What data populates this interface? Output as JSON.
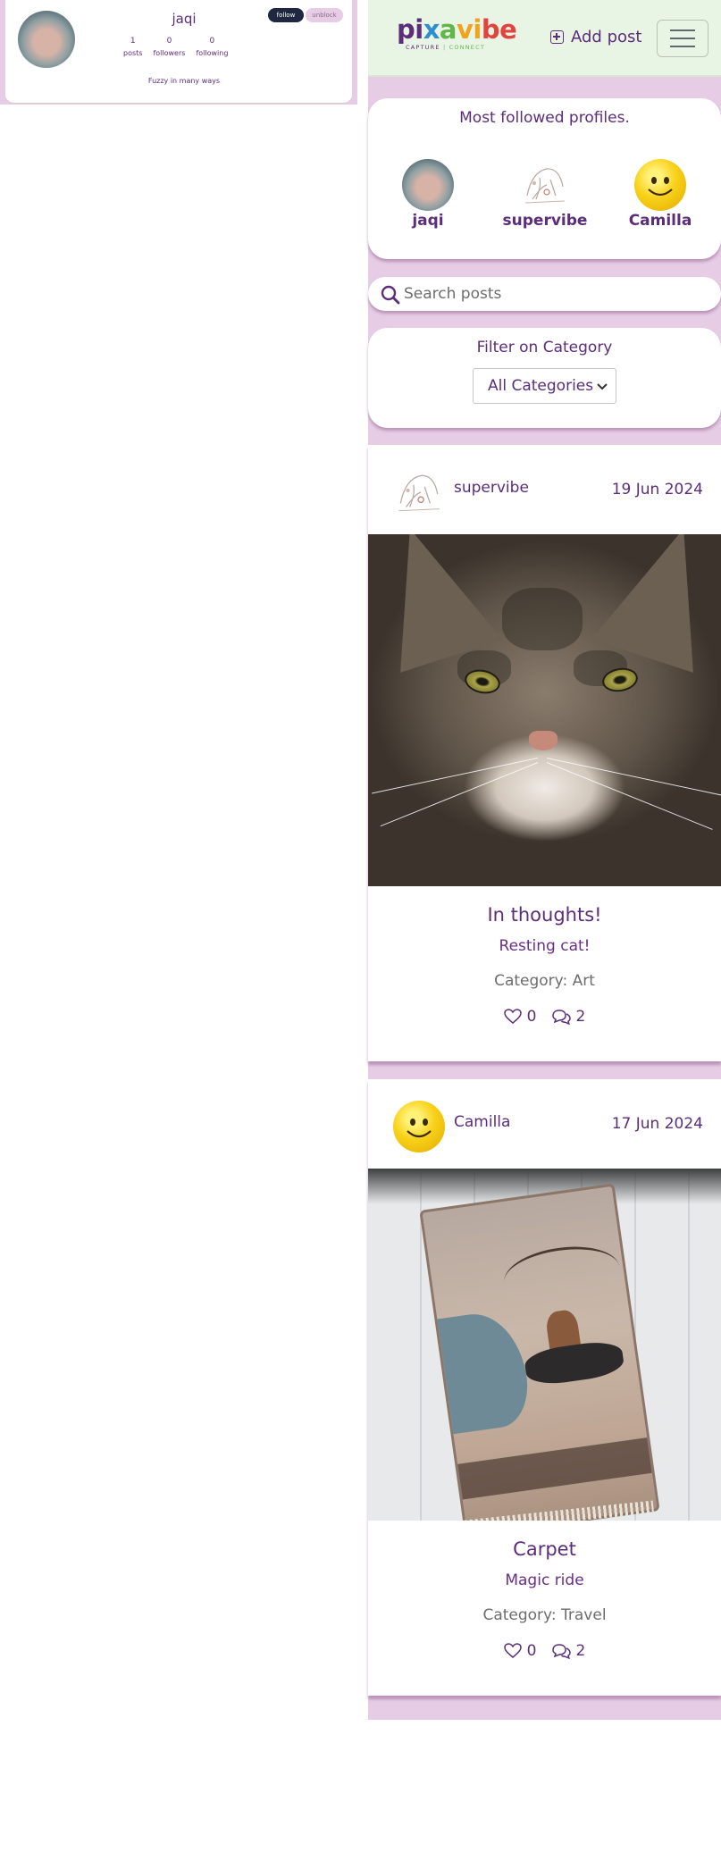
{
  "profile": {
    "name": "jaqi",
    "stats": [
      {
        "value": "1",
        "label": "posts"
      },
      {
        "value": "0",
        "label": "followers"
      },
      {
        "value": "0",
        "label": "following"
      }
    ],
    "follow_label": "follow",
    "unblock_label": "unblock",
    "bio": "Fuzzy in many ways"
  },
  "navbar": {
    "logo": {
      "letters": [
        "pi",
        "x",
        "a",
        "vi",
        "be"
      ],
      "tagline_left": "CAPTURE",
      "tagline_sep": "|",
      "tagline_right": "CONNECT"
    },
    "add_post_label": "Add post",
    "menu_icon": "hamburger-menu-icon"
  },
  "most_followed": {
    "title": "Most followed profiles.",
    "profiles": [
      {
        "name": "jaqi",
        "avatar": "photo"
      },
      {
        "name": "supervibe",
        "avatar": "sketch"
      },
      {
        "name": "Camilla",
        "avatar": "smiley"
      }
    ]
  },
  "search": {
    "placeholder": "Search posts",
    "value": "",
    "icon": "search-icon"
  },
  "filter": {
    "title": "Filter on Category",
    "selected": "All Categories",
    "icon": "chevron-down-icon"
  },
  "posts": [
    {
      "user": "supervibe",
      "date": "19 Jun 2024",
      "image": "cat",
      "title": "In thoughts!",
      "subtitle": "Resting cat!",
      "category": "Category: Art",
      "likes": "0",
      "comments": "2"
    },
    {
      "user": "Camilla",
      "date": "17 Jun 2024",
      "image": "carpet",
      "title": "Carpet",
      "subtitle": "Magic ride",
      "category": "Category: Travel",
      "likes": "0",
      "comments": "2"
    }
  ],
  "colors": {
    "brand_purple": "#5b2d7a",
    "page_background": "#e6cce4",
    "navbar_background": "#e9f5e4",
    "follow_button": "#1f2840"
  }
}
